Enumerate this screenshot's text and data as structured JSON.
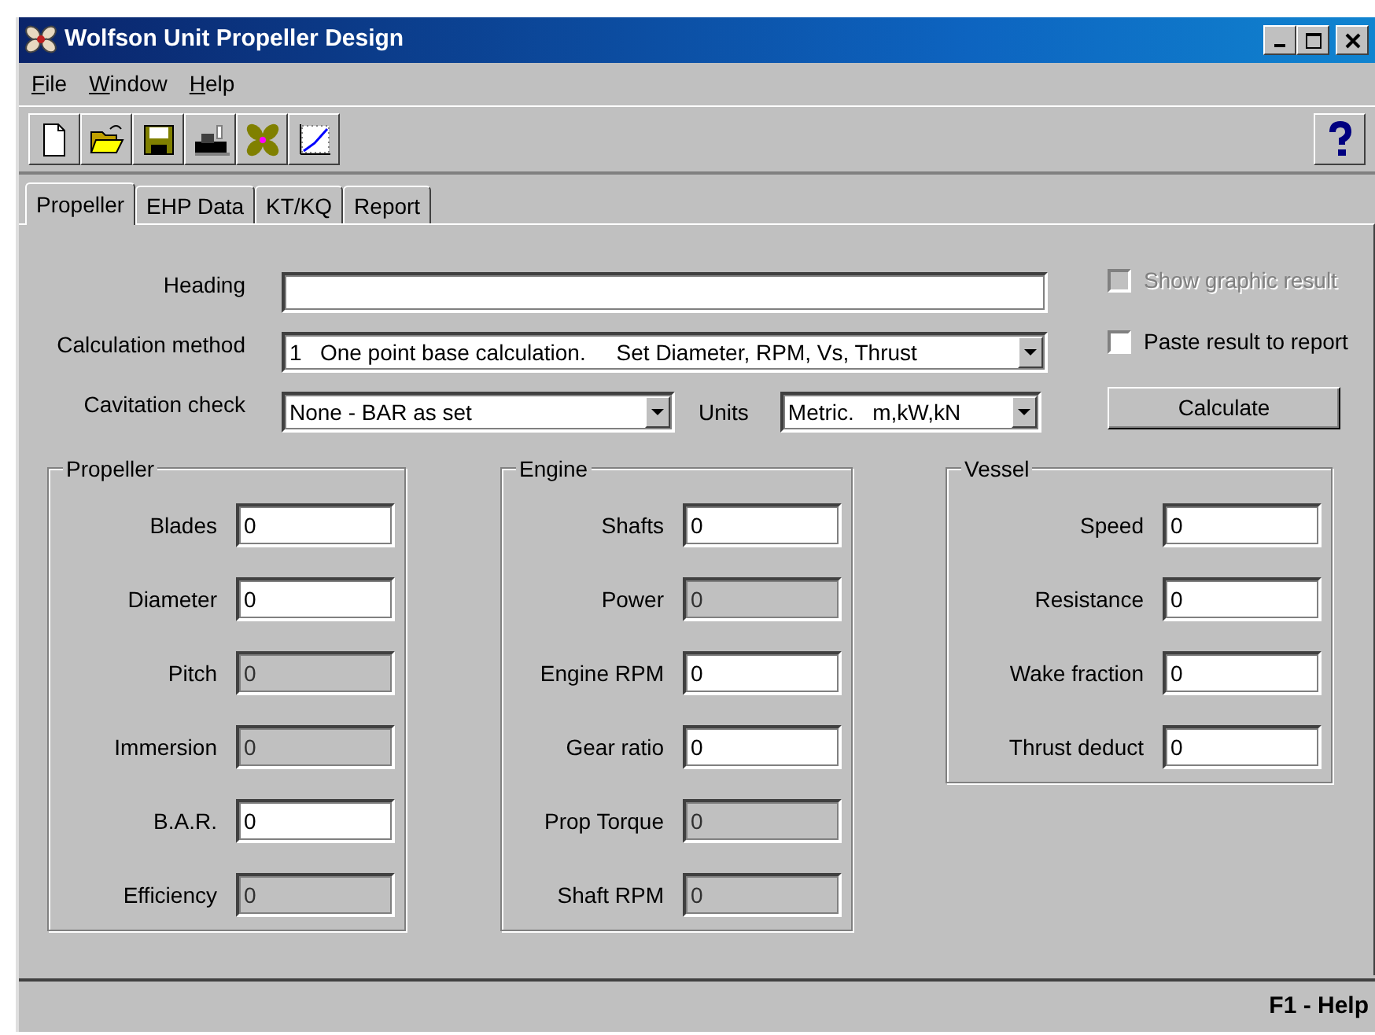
{
  "window": {
    "title": "Wolfson Unit Propeller Design"
  },
  "menu": [
    {
      "label": "File"
    },
    {
      "label": "Window"
    },
    {
      "label": "Help"
    }
  ],
  "toolbar": [
    {
      "kind": "new"
    },
    {
      "kind": "open"
    },
    {
      "kind": "save"
    },
    {
      "kind": "print"
    },
    {
      "kind": "propeller"
    },
    {
      "kind": "chart"
    }
  ],
  "tabs": [
    {
      "label": "Propeller",
      "selected": true
    },
    {
      "label": "EHP Data",
      "selected": false
    },
    {
      "label": "KT/KQ",
      "selected": false
    },
    {
      "label": "Report",
      "selected": false
    }
  ],
  "heading": {
    "label": "Heading"
  },
  "calculation_method": {
    "label": "Calculation method",
    "value": "1   One point base calculation.     Set Diameter, RPM, Vs, Thrust"
  },
  "cavitation_check": {
    "label": "Cavitation check",
    "value": "None - BAR as set"
  },
  "units": {
    "label": "Units",
    "value": "Metric.   m,kW,kN"
  },
  "options": [
    {
      "label": "Show graphic result",
      "checked": false,
      "disabled": true
    },
    {
      "label": "Paste result to report",
      "checked": false,
      "disabled": false
    }
  ],
  "calculate_button": "Calculate",
  "groups": [
    {
      "title": "Propeller",
      "fields": [
        {
          "label": "Blades",
          "value": "0",
          "disabled": false
        },
        {
          "label": "Diameter",
          "value": "0",
          "disabled": false
        },
        {
          "label": "Pitch",
          "value": "0",
          "disabled": true
        },
        {
          "label": "Immersion",
          "value": "0",
          "disabled": true
        },
        {
          "label": "B.A.R.",
          "value": "0",
          "disabled": false
        },
        {
          "label": "Efficiency",
          "value": "0",
          "disabled": true
        }
      ]
    },
    {
      "title": "Engine",
      "fields": [
        {
          "label": "Shafts",
          "value": "0",
          "disabled": false
        },
        {
          "label": "Power",
          "value": "0",
          "disabled": true
        },
        {
          "label": "Engine RPM",
          "value": "0",
          "disabled": false
        },
        {
          "label": "Gear ratio",
          "value": "0",
          "disabled": false
        },
        {
          "label": "Prop Torque",
          "value": "0",
          "disabled": true
        },
        {
          "label": "Shaft RPM",
          "value": "0",
          "disabled": true
        }
      ]
    },
    {
      "title": "Vessel",
      "fields": [
        {
          "label": "Speed",
          "value": "0",
          "disabled": false
        },
        {
          "label": "Resistance",
          "value": "0",
          "disabled": false
        },
        {
          "label": "Wake fraction",
          "value": "0",
          "disabled": false
        },
        {
          "label": "Thrust deduct",
          "value": "0",
          "disabled": false
        }
      ]
    }
  ],
  "status_bar": {
    "help": "F1 - Help"
  }
}
